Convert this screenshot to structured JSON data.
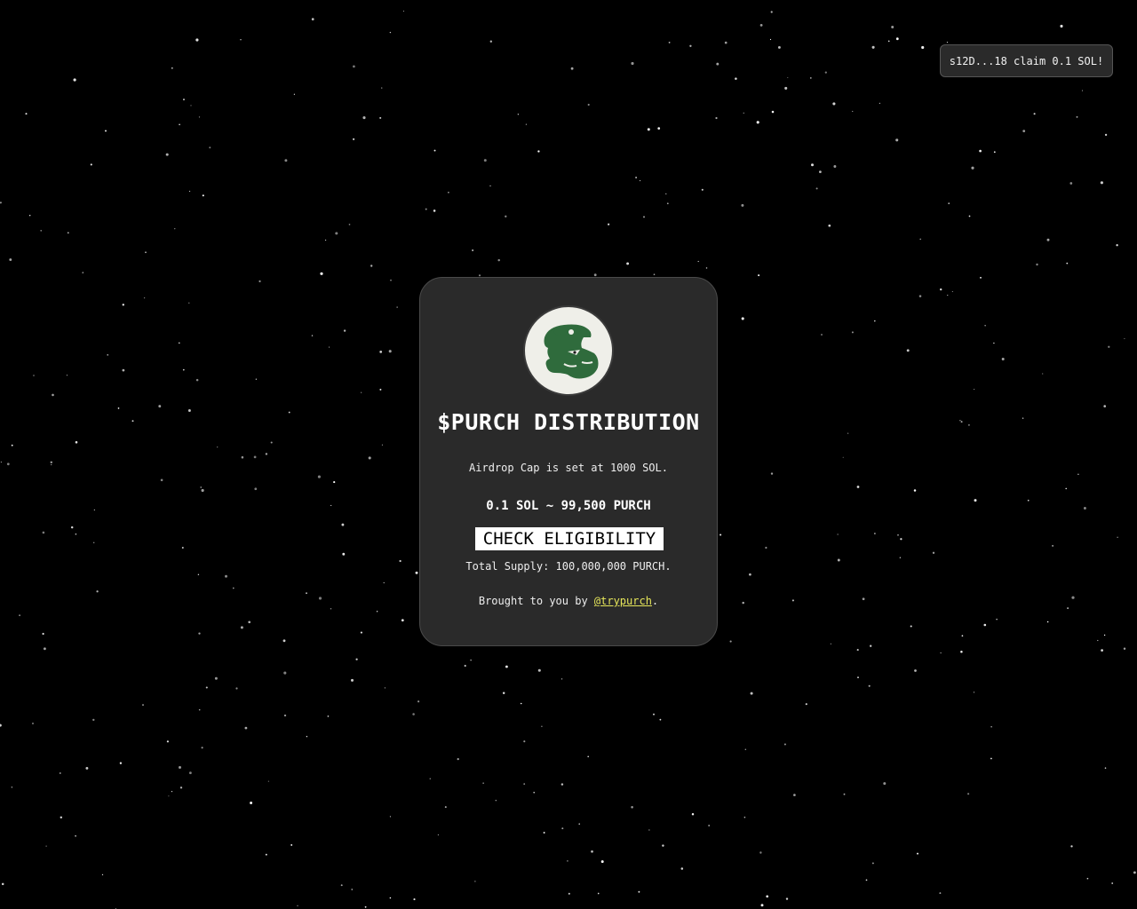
{
  "toast": {
    "text": "s12D...18 claim 0.1 SOL!"
  },
  "card": {
    "title": "$PURCH DISTRIBUTION",
    "cap_text": "Airdrop Cap is set at 1000 SOL.",
    "rate_text": "0.1 SOL ~ 99,500 PURCH",
    "check_button_label": "CHECK ELIGIBILITY",
    "supply_text": "Total Supply: 100,000,000 PURCH.",
    "credit_prefix": "Brought to you by ",
    "credit_link": "@trypurch",
    "credit_suffix": "."
  },
  "logo": {
    "icon": "panther-icon",
    "fill_color": "#2f6b3c",
    "background_color": "#efefe9"
  },
  "colors": {
    "page_background": "#000000",
    "card_background": "#2a2a2a",
    "link": "#e6e65a",
    "button_background": "#ffffff"
  }
}
